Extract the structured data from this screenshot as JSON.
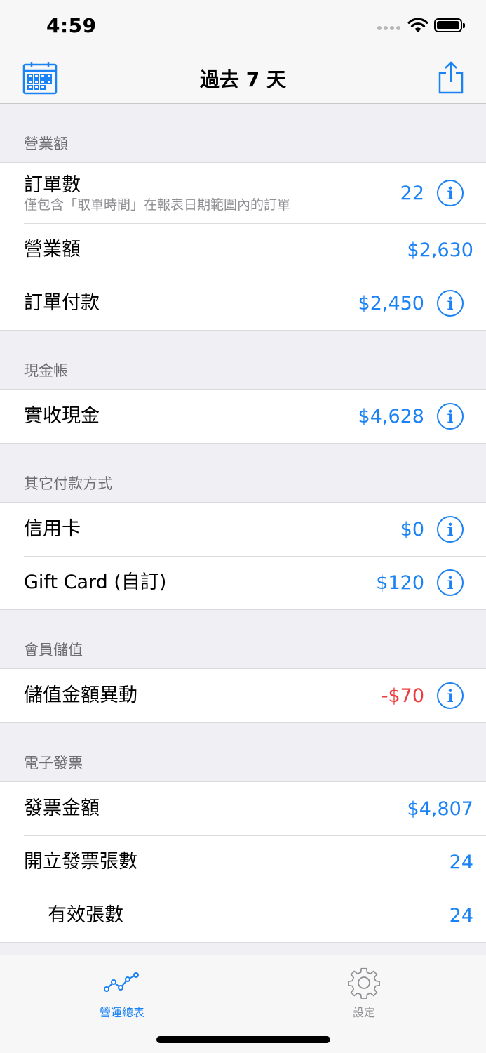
{
  "status": {
    "time": "4:59"
  },
  "nav": {
    "title": "過去 7 天"
  },
  "sections": [
    {
      "header": "營業額",
      "rows": [
        {
          "label": "訂單數",
          "sub": "僅包含「取單時間」在報表日期範圍內的訂單",
          "value": "22",
          "info": true
        },
        {
          "label": "營業額",
          "value": "$2,630",
          "info": false
        },
        {
          "label": "訂單付款",
          "value": "$2,450",
          "info": true
        }
      ]
    },
    {
      "header": "現金帳",
      "rows": [
        {
          "label": "實收現金",
          "value": "$4,628",
          "info": true
        }
      ]
    },
    {
      "header": "其它付款方式",
      "rows": [
        {
          "label": "信用卡",
          "value": "$0",
          "info": true
        },
        {
          "label": "Gift Card (自訂)",
          "value": "$120",
          "info": true
        }
      ]
    },
    {
      "header": "會員儲值",
      "rows": [
        {
          "label": "儲值金額異動",
          "value": "-$70",
          "info": true,
          "negative": true
        }
      ]
    },
    {
      "header": "電子發票",
      "rows": [
        {
          "label": "發票金額",
          "value": "$4,807",
          "info": false
        },
        {
          "label": "開立發票張數",
          "value": "24",
          "info": false
        },
        {
          "label": "有效張數",
          "value": "24",
          "info": false,
          "indent": true
        }
      ]
    }
  ],
  "tabs": [
    {
      "label": "營運總表",
      "icon": "chart-line-icon",
      "active": true
    },
    {
      "label": "設定",
      "icon": "gear-icon",
      "active": false
    }
  ],
  "colors": {
    "accent": "#1a82f4",
    "negative": "#ef3b3b"
  }
}
